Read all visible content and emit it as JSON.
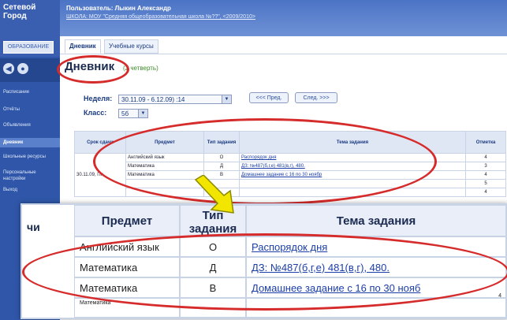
{
  "header": {
    "logo_line1": "Сетевой",
    "logo_line2": "Город",
    "logo_badge": "ОБРАЗОВАНИЕ",
    "user_line": "Пользователь: Лыкин Александр",
    "school_line": "ШКОЛА: МОУ \"Средняя общеобразовательная школа №??\", <2009/2010>"
  },
  "tabs": [
    {
      "label": "Дневник"
    },
    {
      "label": "Учебные курсы"
    }
  ],
  "sidebar": {
    "icons": [
      "◀",
      "●"
    ],
    "items": [
      {
        "label": "Расписание"
      },
      {
        "label": "Отчёты"
      },
      {
        "label": "Объявления"
      },
      {
        "label": "Дневник"
      },
      {
        "label": "Школьные ресурсы"
      },
      {
        "label": "Персональные настройки"
      },
      {
        "label": "Выход"
      }
    ]
  },
  "page": {
    "title": "Дневник",
    "subtitle": "(2 четверть)"
  },
  "controls": {
    "week_label": "Неделя:",
    "week_value": "30.11.09 - 6.12.09) :14",
    "prev_button": "<<< Пред.",
    "next_button": "След. >>>",
    "class_label": "Класс:",
    "class_value": "5б"
  },
  "table": {
    "headers": [
      "Срок сдачи",
      "Предмет",
      "Тип задания",
      "Тема задания",
      "Отметка"
    ],
    "date": "30.11.09, Пн",
    "rows": [
      {
        "subject": "Английский язык",
        "type": "О",
        "topic": "Распорядок дня",
        "mark": "4"
      },
      {
        "subject": "Математика",
        "type": "Д",
        "topic": "ДЗ: №487(б,г,е) 481(в,г), 480.",
        "mark": "3"
      },
      {
        "subject": "Математика",
        "type": "В",
        "topic": "Домашнее задание с 16 по 30 ноябр",
        "mark": "4"
      },
      {
        "subject": "",
        "type": "",
        "topic": "",
        "mark": "5"
      },
      {
        "subject": "",
        "type": "",
        "topic": "",
        "mark": "4"
      }
    ]
  },
  "zoom": {
    "headers": {
      "subject": "Предмет",
      "type": "Тип задания",
      "topic": "Тема задания"
    },
    "left_fragment": "чи",
    "rows": [
      {
        "subject": "Английский язык",
        "type": "О",
        "topic": "Распорядок дня"
      },
      {
        "subject": "Математика",
        "type": "Д",
        "topic": "ДЗ: №487(б,г,е) 481(в,г), 480."
      },
      {
        "subject": "Математика",
        "type": "В",
        "topic": "Домашнее задание с 16 по 30 нояб"
      }
    ],
    "tail_subject": "Математика",
    "tail_mark": "4"
  },
  "colors": {
    "accent": "#2f56a8",
    "highlight": "#d62b2b",
    "arrow": "#f2e600"
  }
}
